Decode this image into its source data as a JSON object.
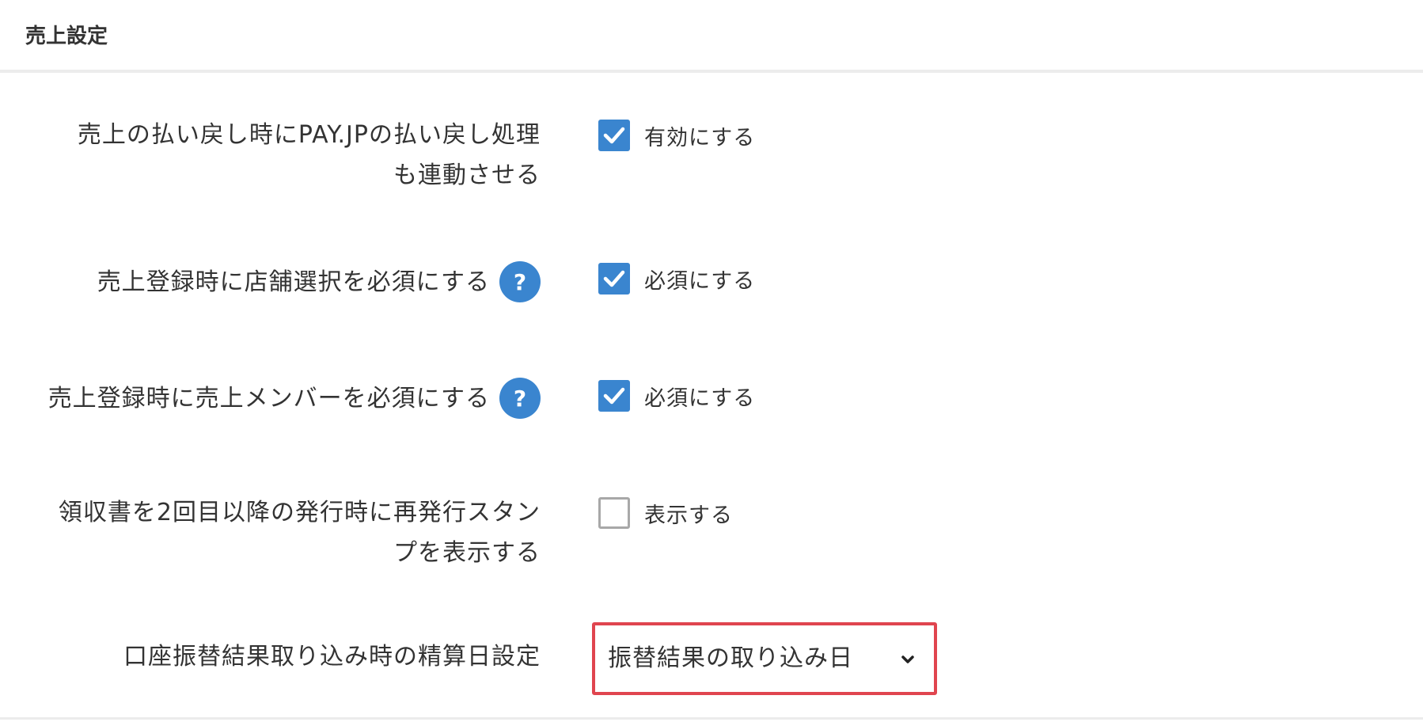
{
  "section": {
    "title": "売上設定"
  },
  "rows": [
    {
      "label_line1": "売上の払い戻し時にPAY.JPの払い戻し処理",
      "label_line2": "も連動させる",
      "checked": true,
      "option_label": "有効にする"
    },
    {
      "label": "売上登録時に店舗選択を必須にする",
      "help_icon": "question-icon",
      "help_glyph": "?",
      "checked": true,
      "option_label": "必須にする"
    },
    {
      "label": "売上登録時に売上メンバーを必須にする",
      "help_icon": "question-icon",
      "help_glyph": "?",
      "checked": true,
      "option_label": "必須にする"
    },
    {
      "label_line1": "領収書を2回目以降の発行時に再発行スタン",
      "label_line2": "プを表示する",
      "checked": false,
      "option_label": "表示する"
    },
    {
      "label": "口座振替結果取り込み時の精算日設定",
      "select_value": "振替結果の取り込み日",
      "select_icon": "chevron-down-icon"
    }
  ],
  "colors": {
    "accent": "#3a85cf",
    "highlight_border": "#e0454f",
    "divider": "#ececec",
    "unchecked_border": "#a8a8a8",
    "text": "#333333"
  }
}
